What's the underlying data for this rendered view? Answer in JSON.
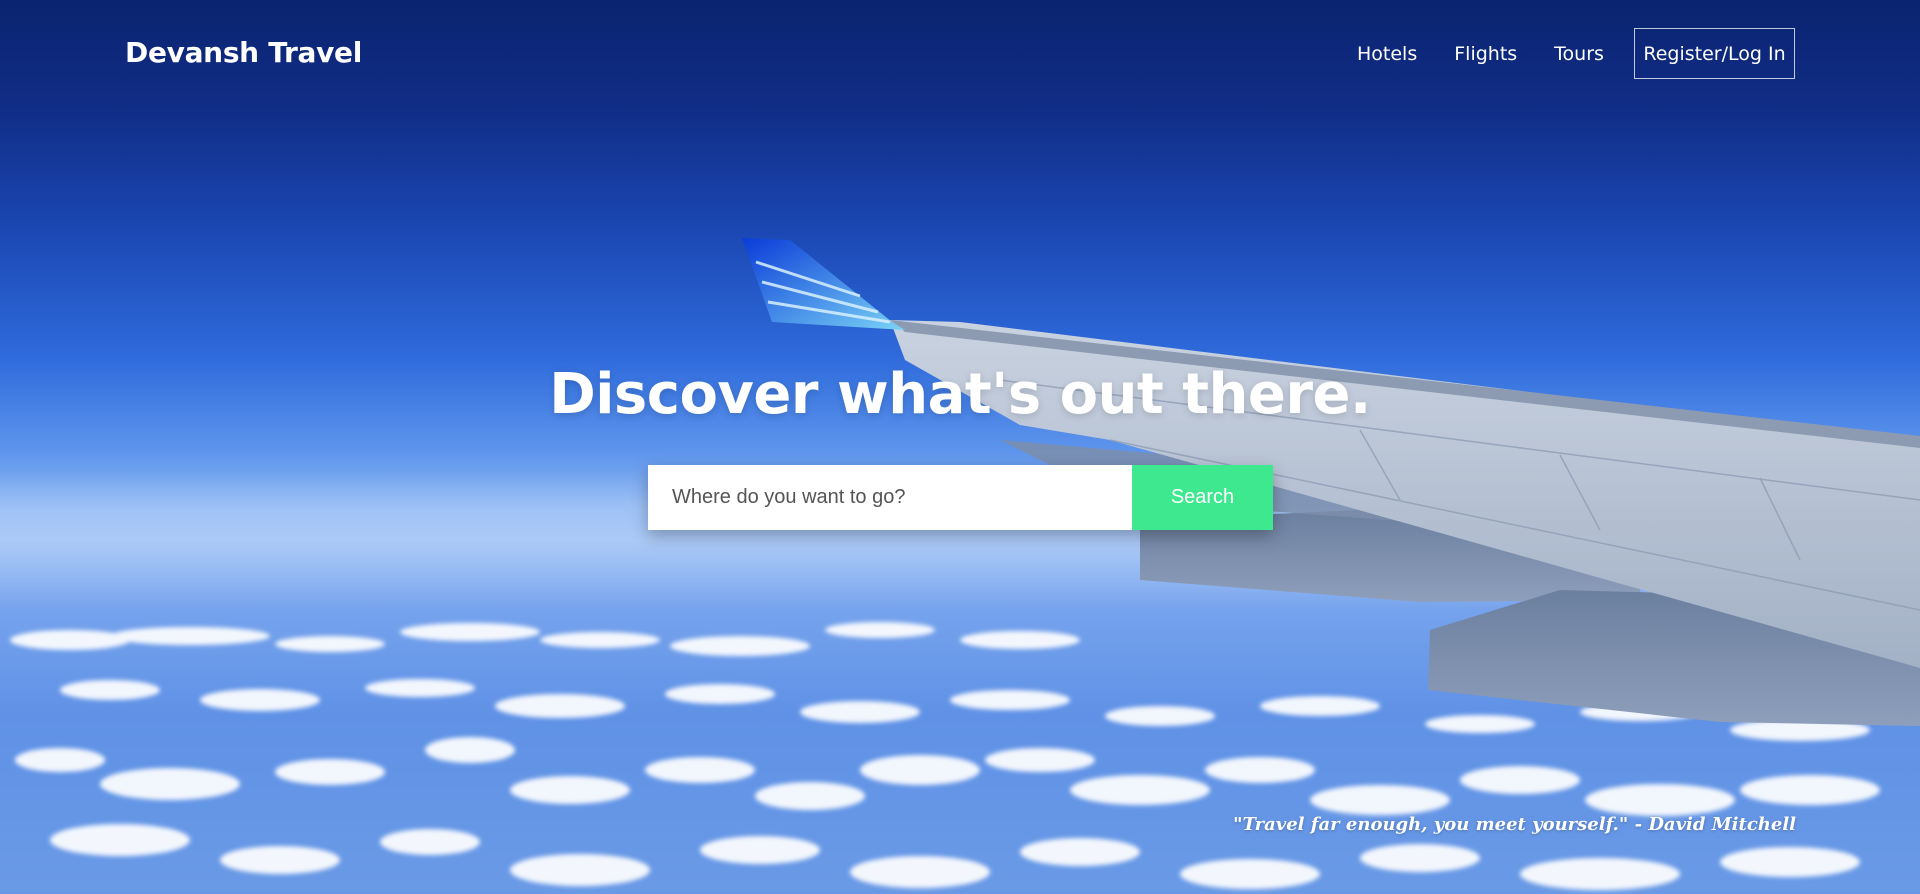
{
  "brand": {
    "name": "Devansh Travel"
  },
  "nav": {
    "links": [
      "Hotels",
      "Flights",
      "Tours"
    ],
    "auth_label": "Register/Log In"
  },
  "hero": {
    "headline": "Discover what's out there.",
    "quote": "\"Travel far enough, you meet yourself.\" - David Mitchell"
  },
  "search": {
    "placeholder": "Where do you want to go?",
    "value": "",
    "button_label": "Search"
  },
  "colors": {
    "accent": "#3ee88e",
    "sky_top": "#0b2470",
    "text": "#ffffff"
  }
}
